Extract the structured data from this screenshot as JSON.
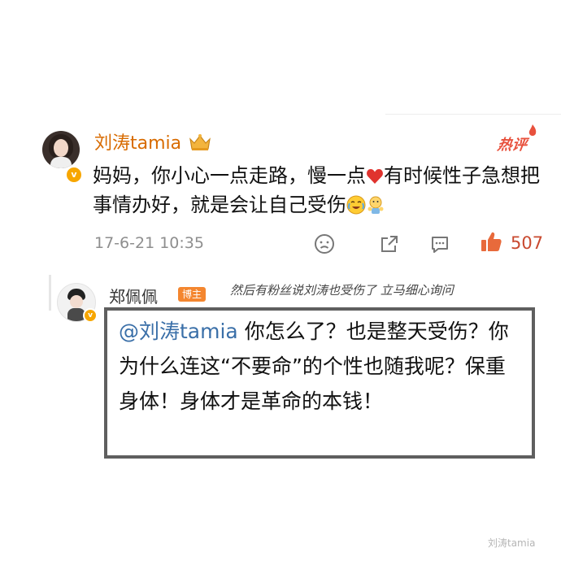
{
  "main_comment": {
    "username": "刘涛tamia",
    "hot_label": "热评",
    "text_part1": "妈妈，你小心一点走路，慢一点",
    "text_part2": "有时候性子急想把事情办好，就是会让自己受伤",
    "time": "17-6-21 10:35",
    "like_count": "507",
    "verified_badge": "v",
    "icons": [
      "crown-icon",
      "heart-icon",
      "crying-laughing-emoji-icon",
      "thumbs-up-doll-emoji-icon",
      "sad-face-icon",
      "share-icon",
      "comment-icon",
      "like-icon"
    ]
  },
  "reply": {
    "username": "郑佩佩",
    "badge": "博主",
    "annotation": "然后有粉丝说刘涛也受伤了 立马细心询问",
    "mention": "@刘涛tamia",
    "text": " 你怎么了？也是整天受伤？你为什么连这“不要命”的个性也随我呢？保重身体！身体才是革命的本钱！",
    "verified_badge": "v"
  },
  "watermark": "刘涛tamia",
  "colors": {
    "username_orange": "#d86b00",
    "hot_red": "#e8513d",
    "like_red": "#c9492f",
    "mention_blue": "#3a6fa8",
    "badge_orange": "#f4862f",
    "box_border": "#5f5f5f"
  }
}
